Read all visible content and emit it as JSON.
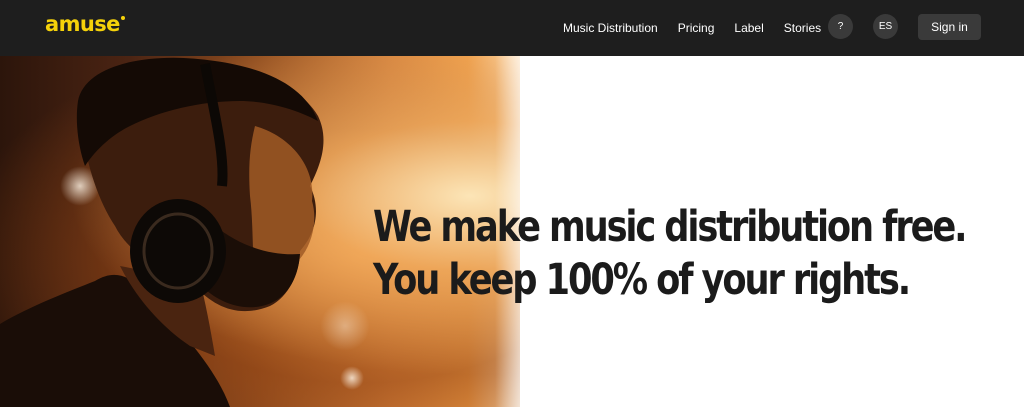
{
  "brand": {
    "logo_text": "amuse",
    "accent_color": "#f5d20a"
  },
  "nav": {
    "items": [
      {
        "label": "Music Distribution"
      },
      {
        "label": "Pricing"
      },
      {
        "label": "Label"
      },
      {
        "label": "Stories"
      }
    ],
    "help_label": "?",
    "language_label": "ES",
    "signin_label": "Sign in"
  },
  "hero": {
    "headline_line1": "We make music distribution free.",
    "headline_line2": "You keep 100% of your rights.",
    "image_icon": "person-with-headphones-photo"
  },
  "colors": {
    "topbar": "#1e1e1e",
    "button_bg": "#3a3a3a",
    "headline": "#1b1b1b"
  }
}
